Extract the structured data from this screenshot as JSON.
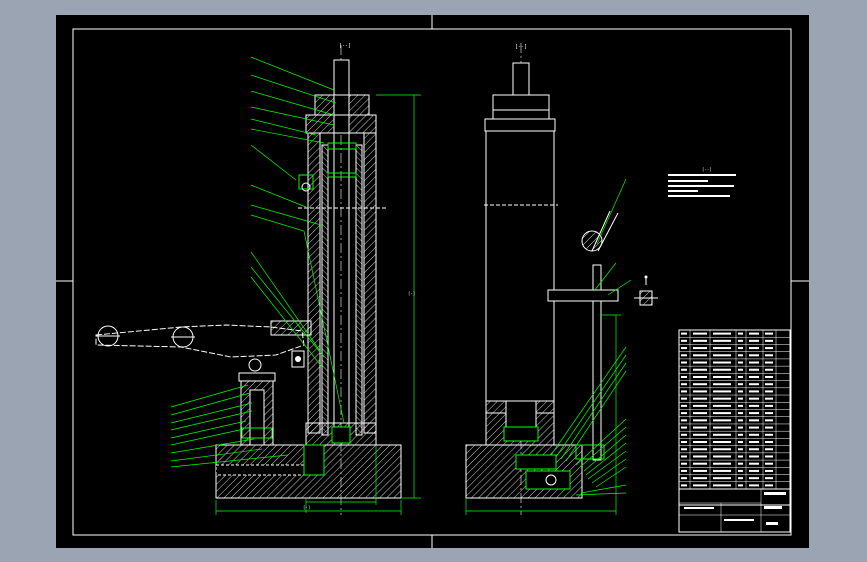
{
  "colors": {
    "background": "#000000",
    "window_frame": "#9aa4b2",
    "outline": "#ffffff",
    "dimension": "#00ff00",
    "hatch": "#ffffff",
    "text": "#ffffff"
  },
  "technical_notes": {
    "lines": [
      "",
      "",
      "",
      "",
      ""
    ]
  },
  "title_block": {
    "drawing_no": "",
    "part_name": "",
    "unit": ""
  },
  "views": {
    "front": "section-view",
    "side": "side-elevation-view"
  }
}
